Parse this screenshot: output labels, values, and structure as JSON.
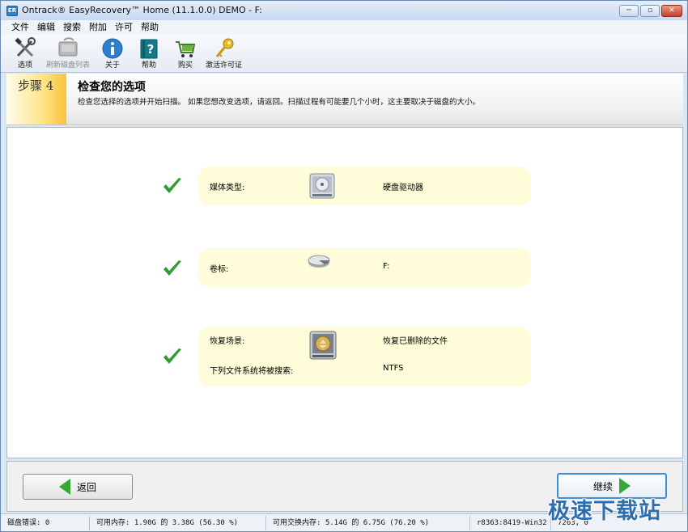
{
  "window": {
    "title": "Ontrack® EasyRecovery™ Home (11.1.0.0) DEMO - F:",
    "app_icon_text": "ER",
    "minimize_glyph": "─",
    "maximize_glyph": "▫",
    "close_glyph": "✕"
  },
  "menu": [
    "文件",
    "编辑",
    "搜索",
    "附加",
    "许可",
    "帮助"
  ],
  "toolbar": {
    "options": "选项",
    "refresh_disks": "刷新磁盘列表",
    "about": "关于",
    "help": "帮助",
    "buy": "购买",
    "activate": "激活许可证"
  },
  "step": {
    "badge": "步骤 4",
    "title": "检查您的选项",
    "description": "检查您选择的选项并开始扫描。 如果您想改变选项，请返回。扫描过程有可能要几个小时，这主要取决于磁盘的大小。"
  },
  "review": {
    "media_type_label": "媒体类型:",
    "media_type_value": "硬盘驱动器",
    "volume_label": "卷标:",
    "volume_value": "F:",
    "scenario_label": "恢复场景:",
    "scenario_value": "恢复已删除的文件",
    "fs_label": "下列文件系统将被搜索:",
    "fs_value": "NTFS"
  },
  "buttons": {
    "back": "返回",
    "continue": "继续"
  },
  "status": {
    "disk_errors": "磁盘错误: 0",
    "free_memory": "可用内存: 1.90G 的 3.38G (56.30 %)",
    "free_swap": "可用交换内存: 5.14G 的 6.75G (76.20 %)",
    "build": "r8363:8419-Win32",
    "misc": "7263, 0"
  },
  "watermark": "极速下载站",
  "colors": {
    "card_bg": "#fffcd9",
    "check_green": "#2f9e2f",
    "accent_blue": "#3c8fd8"
  }
}
